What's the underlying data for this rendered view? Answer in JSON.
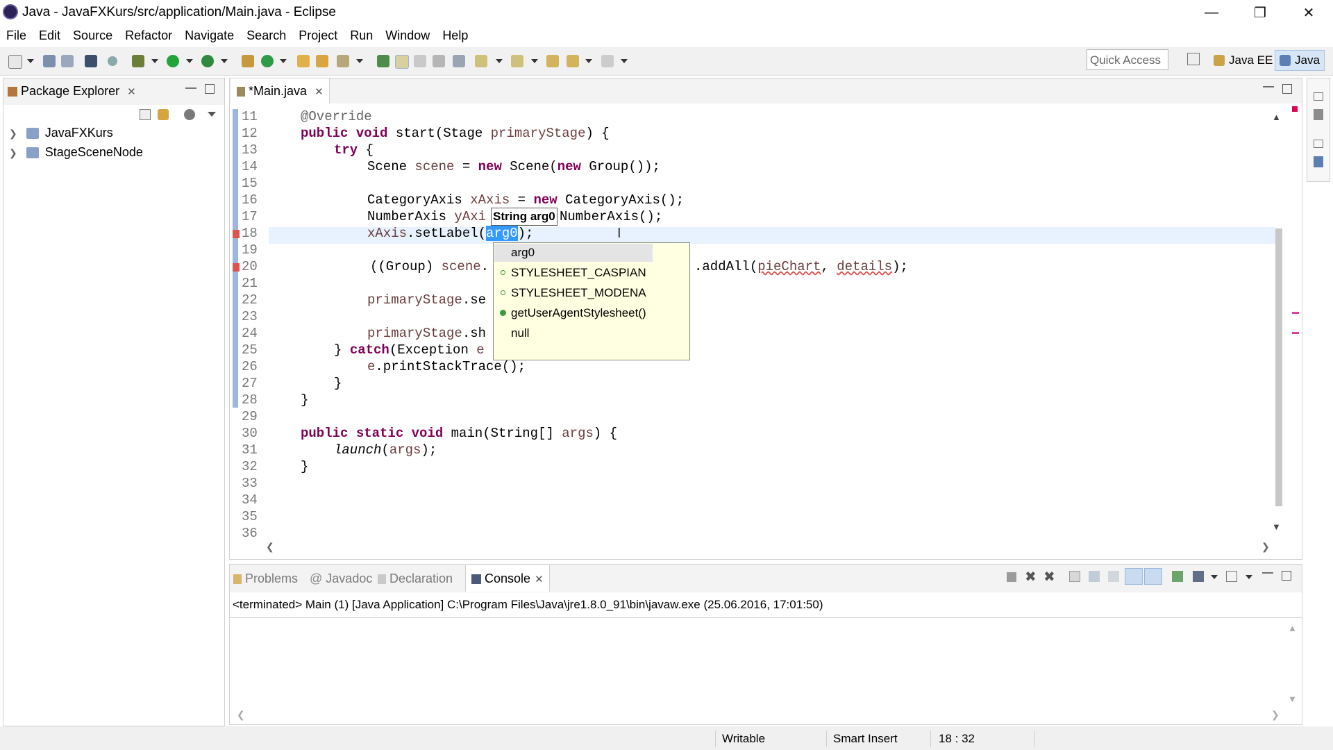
{
  "window": {
    "title": "Java - JavaFXKurs/src/application/Main.java - Eclipse"
  },
  "menubar": [
    "File",
    "Edit",
    "Source",
    "Refactor",
    "Navigate",
    "Search",
    "Project",
    "Run",
    "Window",
    "Help"
  ],
  "toolbar": {
    "quick_access_placeholder": "Quick Access",
    "perspectives": [
      "Java EE",
      "Java"
    ],
    "icons": [
      "new-icon",
      "save-icon",
      "save-all-icon",
      "terminal-icon",
      "skip-breakpoints-icon",
      "debug-icon",
      "run-icon",
      "external-tools-icon",
      "new-java-project-icon",
      "new-class-icon",
      "open-type-icon",
      "search-icon",
      "toggle-mark-occurrences-icon",
      "block-selection-icon",
      "show-whitespace-icon",
      "next-annotation-icon",
      "previous-annotation-icon",
      "back-icon",
      "forward-icon"
    ]
  },
  "package_explorer": {
    "title": "Package Explorer",
    "projects": [
      "JavaFXKurs",
      "StageSceneNode"
    ]
  },
  "editor": {
    "tab_title": "*Main.java",
    "line_numbers": [
      "11",
      "12",
      "13",
      "14",
      "15",
      "16",
      "17",
      "18",
      "19",
      "20",
      "21",
      "22",
      "23",
      "24",
      "25",
      "26",
      "27",
      "28",
      "29",
      "30",
      "31",
      "32",
      "33",
      "34",
      "35",
      "36"
    ],
    "code": {
      "l11_ann": "@Override",
      "l12_kw": "public void",
      "l12_rest": " start(Stage ",
      "l12_param": "primaryStage",
      "l12_end": ") {",
      "l13_kw": "try",
      "l13_end": " {",
      "l14_a": "Scene ",
      "l14_var": "scene",
      "l14_b": " = ",
      "l14_kw1": "new",
      "l14_c": " Scene(",
      "l14_kw2": "new",
      "l14_d": " Group());",
      "l16_a": "CategoryAxis ",
      "l16_var": "xAxis",
      "l16_b": " = ",
      "l16_kw": "new",
      "l16_c": " CategoryAxis();",
      "l17_a": "NumberAxis ",
      "l17_var": "yAxi",
      "l17_c": "NumberAxis();",
      "l18_var": "xAxis",
      "l18_a": ".setLabel(",
      "l18_sel": "arg0",
      "l18_b": ");",
      "l20_a": "((Group) ",
      "l20_var": "scene",
      "l20_b": ".",
      "l20_c": ".addAll(",
      "l20_v1": "pieChart",
      "l20_d": ", ",
      "l20_v2": "details",
      "l20_e": ");",
      "l22_var": "primaryStage",
      "l22_a": ".se",
      "l24_var": "primaryStage",
      "l24_a": ".sh",
      "l25_a": "} ",
      "l25_kw": "catch",
      "l25_b": "(Exception ",
      "l25_var": "e",
      "l26_var": "e",
      "l26_a": ".printStackTrace();",
      "l27": "}",
      "l28": "}",
      "l30_kw": "public static void",
      "l30_a": " main(String[] ",
      "l30_param": "args",
      "l30_b": ") {",
      "l31_fn": "launch",
      "l31_a": "(",
      "l31_param": "args",
      "l31_b": ");",
      "l32": "}"
    }
  },
  "content_assist": {
    "tooltip": "String arg0",
    "items": [
      "arg0",
      "STYLESHEET_CASPIAN",
      "STYLESHEET_MODENA",
      "getUserAgentStylesheet()",
      "null"
    ]
  },
  "bottom_panel": {
    "tabs": [
      "Problems",
      "Javadoc",
      "Declaration",
      "Console"
    ],
    "active_tab": "Console",
    "console_header": "<terminated> Main (1) [Java Application] C:\\Program Files\\Java\\jre1.8.0_91\\bin\\javaw.exe (25.06.2016, 17:01:50)"
  },
  "statusbar": {
    "mode": "Writable",
    "insert": "Smart Insert",
    "position": "18 : 32"
  },
  "colors": {
    "keyword": "#7f0055",
    "selection": "#3399ff",
    "popup_bg": "#ffffe1",
    "annotation": "#646464"
  }
}
